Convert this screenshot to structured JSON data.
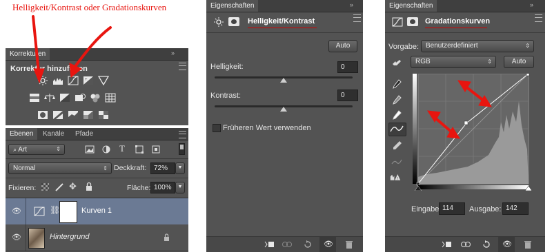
{
  "annotation": {
    "text": "Helligkeit/Kontrast oder Gradationskurven",
    "color": "#e8150f"
  },
  "korrekturen_panel": {
    "tab": "Korrekturen",
    "header": "Korrektur hinzufügen",
    "icons_row1": [
      "brightness-icon",
      "levels-icon",
      "curves-icon",
      "exposure-icon",
      "vibrance-triangle-icon"
    ],
    "icons_row2": [
      "hue-saturation-icon",
      "color-balance-icon",
      "black-white-icon",
      "photo-filter-icon",
      "channel-mixer-icon",
      "color-lookup-icon"
    ],
    "icons_row3": [
      "invert-icon",
      "posterize-icon",
      "threshold-icon",
      "gradient-map-icon",
      "selective-color-icon"
    ]
  },
  "layers_panel": {
    "tabs": [
      "Ebenen",
      "Kanäle",
      "Pfade"
    ],
    "filter_kind": "Art",
    "blend_mode": "Normal",
    "opacity_label": "Deckkraft:",
    "opacity_value": "72%",
    "lock_label": "Fixieren:",
    "fill_label": "Fläche:",
    "fill_value": "100%",
    "layers": [
      {
        "name": "Kurven 1",
        "selected": true
      },
      {
        "name": "Hintergrund",
        "selected": false,
        "locked": true
      }
    ]
  },
  "brightness_panel": {
    "tab": "Eigenschaften",
    "title": "Helligkeit/Kontrast",
    "auto_label": "Auto",
    "brightness_label": "Helligkeit:",
    "brightness_value": "0",
    "contrast_label": "Kontrast:",
    "contrast_value": "0",
    "legacy_label": "Früheren Wert verwenden",
    "legacy_checked": false
  },
  "curves_panel": {
    "tab": "Eigenschaften",
    "title": "Gradationskurven",
    "preset_label": "Vorgabe:",
    "preset_value": "Benutzerdefiniert",
    "channel_value": "RGB",
    "auto_label": "Auto",
    "input_label": "Eingabe:",
    "input_value": "114",
    "output_label": "Ausgabe:",
    "output_value": "142"
  }
}
